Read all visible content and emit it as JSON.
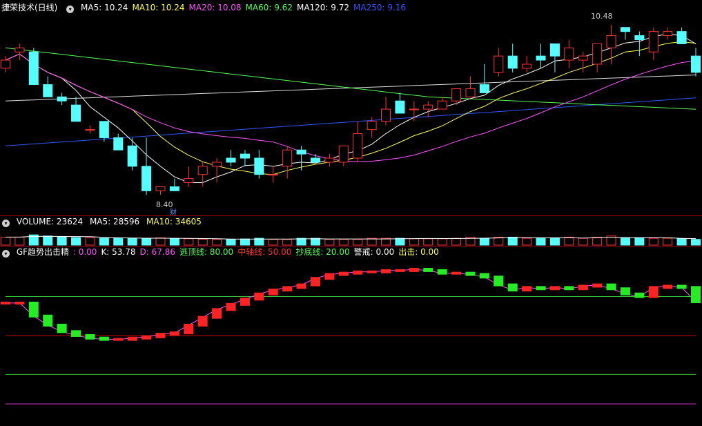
{
  "price_panel": {
    "title": "捷荣技术(日线)",
    "indicators": [
      {
        "label": "MA5: 10.24",
        "color": "#ffffff"
      },
      {
        "label": "MA10: 10.24",
        "color": "#ffff55"
      },
      {
        "label": "MA20: 10.08",
        "color": "#ff55ff"
      },
      {
        "label": "MA60: 9.62",
        "color": "#55ff55"
      },
      {
        "label": "MA120: 9.72",
        "color": "#ffffff"
      },
      {
        "label": "MA250: 9.16",
        "color": "#3355ff"
      }
    ],
    "high_label": "10.48",
    "low_label": "8.40",
    "cai_label": "财"
  },
  "volume_panel": {
    "title": "VOLUME: 23624",
    "ma5": "MA5: 28596",
    "ma10": "MA10: 34605"
  },
  "gf_panel": {
    "title": "GF趋势出击精",
    "items": [
      {
        "label": ": 0.00",
        "color": "#ff55ff"
      },
      {
        "label": "K: 53.78",
        "color": "#ffffff"
      },
      {
        "label": "D: 67.86",
        "color": "#ff55ff"
      },
      {
        "label": "逃顶线: 80.00",
        "color": "#55ff55"
      },
      {
        "label": "中轴线: 50.00",
        "color": "#ff3333"
      },
      {
        "label": "抄底线: 20.00",
        "color": "#55ff55"
      },
      {
        "label": "警戒: 0.00",
        "color": "#ffffff"
      },
      {
        "label": "出击: 0.00",
        "color": "#ffff55"
      }
    ]
  },
  "colors": {
    "up": "#ff3333",
    "down": "#54ffff",
    "bg": "#000000",
    "frame": "#a00000"
  },
  "chart_data": [
    {
      "type": "candlestick",
      "title": "捷荣技术(日线)",
      "x": [
        1,
        2,
        3,
        4,
        5,
        6,
        7,
        8,
        9,
        10,
        11,
        12,
        13,
        14,
        15,
        16,
        17,
        18,
        19,
        20,
        21,
        22,
        23,
        24,
        25,
        26,
        27,
        28,
        29,
        30,
        31,
        32,
        33,
        34,
        35,
        36,
        37,
        38,
        39,
        40,
        41,
        42,
        43,
        44,
        45,
        46,
        47,
        48,
        49,
        50
      ],
      "open": [
        9.95,
        10.15,
        10.15,
        9.75,
        9.6,
        9.5,
        9.2,
        9.3,
        9.1,
        9.0,
        8.75,
        8.45,
        8.5,
        8.55,
        8.65,
        8.75,
        8.85,
        8.9,
        8.85,
        8.65,
        8.75,
        8.95,
        8.85,
        8.8,
        8.8,
        8.85,
        9.2,
        9.3,
        9.55,
        9.45,
        9.45,
        9.45,
        9.55,
        9.6,
        9.75,
        9.9,
        10.1,
        9.95,
        10.1,
        10.25,
        10.05,
        10.05,
        10.0,
        10.2,
        10.45,
        10.35,
        10.15,
        10.35,
        10.4,
        10.1
      ],
      "high": [
        10.1,
        10.25,
        10.2,
        9.85,
        9.65,
        9.6,
        9.25,
        9.3,
        9.15,
        9.1,
        9.1,
        8.5,
        8.6,
        8.75,
        8.8,
        8.85,
        8.95,
        8.95,
        8.95,
        8.75,
        9.0,
        9.0,
        8.9,
        8.9,
        8.95,
        9.3,
        9.35,
        9.6,
        9.65,
        9.55,
        9.55,
        9.6,
        9.7,
        9.85,
        10.0,
        10.2,
        10.25,
        10.1,
        10.25,
        10.25,
        10.3,
        10.15,
        10.15,
        10.48,
        10.45,
        10.4,
        10.45,
        10.45,
        10.45,
        10.2
      ],
      "low": [
        9.9,
        10.05,
        9.75,
        9.6,
        9.5,
        9.3,
        9.15,
        9.05,
        8.95,
        8.7,
        8.4,
        8.4,
        8.45,
        8.5,
        8.5,
        8.55,
        8.75,
        8.75,
        8.6,
        8.55,
        8.6,
        8.7,
        8.8,
        8.75,
        8.75,
        8.8,
        9.1,
        9.25,
        9.4,
        9.3,
        9.35,
        9.45,
        9.5,
        9.6,
        9.7,
        9.85,
        9.9,
        9.9,
        9.95,
        9.9,
        9.95,
        9.9,
        9.9,
        10.0,
        10.3,
        10.1,
        10.05,
        10.3,
        10.25,
        9.85
      ],
      "close": [
        10.05,
        10.2,
        9.75,
        9.6,
        9.55,
        9.3,
        9.2,
        9.1,
        8.95,
        8.75,
        8.45,
        8.5,
        8.45,
        8.6,
        8.75,
        8.8,
        8.8,
        8.85,
        8.65,
        8.65,
        8.95,
        8.9,
        8.8,
        8.85,
        9.0,
        9.15,
        9.3,
        9.45,
        9.4,
        9.45,
        9.5,
        9.55,
        9.7,
        9.7,
        9.65,
        10.1,
        9.95,
        10.0,
        10.05,
        10.1,
        10.2,
        10.1,
        10.25,
        10.35,
        10.4,
        10.3,
        10.4,
        10.4,
        10.25,
        9.9
      ],
      "ylim": [
        8.25,
        10.6
      ]
    },
    {
      "type": "bar",
      "title": "VOLUME: 23624",
      "values": [
        35,
        35,
        45,
        40,
        35,
        33,
        32,
        30,
        30,
        30,
        30,
        32,
        28,
        28,
        26,
        25,
        25,
        27,
        30,
        25,
        25,
        30,
        30,
        25,
        25,
        25,
        30,
        30,
        30,
        28,
        28,
        28,
        30,
        35,
        30,
        35,
        35,
        30,
        30,
        30,
        35,
        30,
        35,
        40,
        30,
        30,
        30,
        30,
        28,
        25
      ]
    },
    {
      "type": "line",
      "title": "GF趋势出击精",
      "k": [
        75,
        75,
        65,
        58,
        53,
        50,
        48,
        47,
        47,
        48,
        49,
        51,
        52,
        58,
        64,
        70,
        74,
        78,
        82,
        85,
        87,
        89,
        94,
        97,
        98,
        99,
        99,
        100,
        100,
        101,
        100,
        98,
        98,
        97,
        95,
        89,
        85,
        87,
        86,
        87,
        86,
        88,
        89,
        86,
        82,
        80,
        87,
        88,
        87,
        76
      ],
      "reference_lines": [
        80,
        50,
        20
      ]
    }
  ]
}
